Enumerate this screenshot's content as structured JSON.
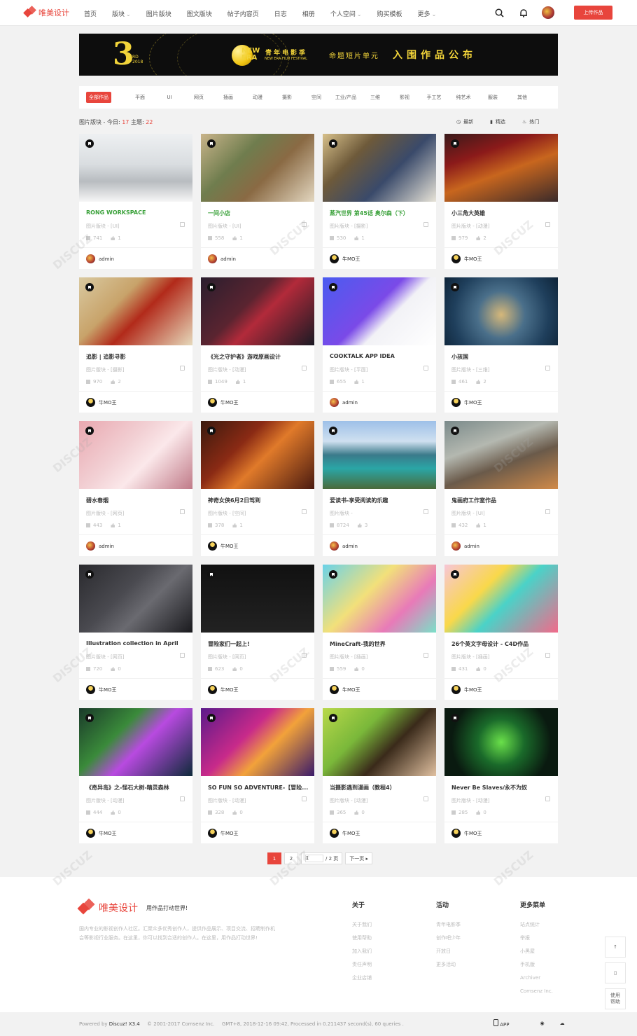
{
  "header": {
    "logo_text": "唯美设计",
    "nav": [
      {
        "label": "首页",
        "sub": false
      },
      {
        "label": "版块",
        "sub": true
      },
      {
        "label": "图片版块",
        "sub": false
      },
      {
        "label": "图文版块",
        "sub": false
      },
      {
        "label": "帖子内容页",
        "sub": false
      },
      {
        "label": "日志",
        "sub": false
      },
      {
        "label": "相册",
        "sub": false
      },
      {
        "label": "个人空间",
        "sub": true
      },
      {
        "label": "购买模板",
        "sub": false
      },
      {
        "label": "更多",
        "sub": true
      }
    ],
    "upload_label": "上传作品",
    "icons": [
      "search-icon",
      "bell-icon",
      "user-avatar"
    ]
  },
  "banner": {
    "num": "3",
    "ordinal": "RD",
    "year": "2018",
    "new_era": "NEW ERA",
    "festival_cn": "青年电影季",
    "festival_en": "NEW ERA FILM FESTIVAL",
    "theme": "命题短片单元",
    "theme2": "入围作品公布"
  },
  "categories": [
    "全部作品",
    "平面",
    "UI",
    "网页",
    "插画",
    "动漫",
    "摄影",
    "空间",
    "工业/产品",
    "三维",
    "影视",
    "手工艺",
    "纯艺术",
    "服装",
    "其他"
  ],
  "stats": {
    "prefix": "图片版块 - 今日: ",
    "today": "17",
    "topics_label": " 主题: ",
    "topics": "22"
  },
  "sort": [
    {
      "label": "最新",
      "icon": "clock-icon"
    },
    {
      "label": "精选",
      "icon": "bookmark-icon"
    },
    {
      "label": "热门",
      "icon": "fire-icon"
    }
  ],
  "cards": [
    {
      "title": "RONG WORKSPACE",
      "green": true,
      "forum": "图片版块 - [UI]",
      "views": "741",
      "likes": "1",
      "user": "admin",
      "avatar": "a",
      "bg": "linear-gradient(180deg,#eef0f2 0%,#d9dde0 45%,#b8bcc0 70%,#f6f6f6 100%)"
    },
    {
      "title": "一间小店",
      "green": true,
      "forum": "图片版块 - [UI]",
      "views": "558",
      "likes": "1",
      "user": "admin",
      "avatar": "a",
      "bg": "linear-gradient(135deg,#c9b48a 0%,#6f7d4e 35%,#8a6a44 60%,#e3d7c0 100%)"
    },
    {
      "title": "蒸汽世界 第45话 奥尔森（下）",
      "green": true,
      "forum": "图片版块 - [摄影]",
      "views": "530",
      "likes": "1",
      "user": "牛MO王",
      "avatar": "n",
      "bg": "linear-gradient(135deg,#d7c08a 0%,#6e5a3a 30%,#3a4a6a 60%,#e8e4d8 100%)"
    },
    {
      "title": "小三角大英雄",
      "green": false,
      "forum": "图片版块 - [动漫]",
      "views": "979",
      "likes": "2",
      "user": "牛MO王",
      "avatar": "n",
      "bg": "linear-gradient(160deg,#3a1a1a 0%,#8b1a1a 30%,#c8661e 55%,#3a2a2a 100%)"
    },
    {
      "title": "追影 | 追影寻影",
      "green": false,
      "forum": "图片版块 - [摄影]",
      "views": "970",
      "likes": "2",
      "user": "牛MO王",
      "avatar": "n",
      "bg": "linear-gradient(135deg,#d9c9a0 0%,#c8a36a 35%,#b22a1a 55%,#e6d9bb 100%)"
    },
    {
      "title": "《光之守护者》游戏原画设计",
      "green": false,
      "forum": "图片版块 - [动漫]",
      "views": "1049",
      "likes": "1",
      "user": "牛MO王",
      "avatar": "n",
      "bg": "linear-gradient(135deg,#2a1e2e 0%,#5a2430 40%,#b22a3a 55%,#1a1a24 100%)"
    },
    {
      "title": "COOKTALK APP IDEA",
      "green": false,
      "forum": "图片版块 - [平面]",
      "views": "655",
      "likes": "1",
      "user": "admin",
      "avatar": "a",
      "bg": "linear-gradient(135deg,#4a5cf0 0%,#7a4ae8 45%,#f2f2f6 60%,#ffffff 100%)"
    },
    {
      "title": "小孩国",
      "green": false,
      "forum": "图片版块 - [三维]",
      "views": "461",
      "likes": "2",
      "user": "牛MO王",
      "avatar": "n",
      "bg": "radial-gradient(circle at 50% 55%,#d6b87a 0%,#4a6f8a 35%,#1f3f5c 70%,#0e2438 100%)"
    },
    {
      "title": "碧水春烟",
      "green": false,
      "forum": "图片版块 - [网页]",
      "views": "443",
      "likes": "1",
      "user": "admin",
      "avatar": "a",
      "bg": "linear-gradient(135deg,#e9a8b0 0%,#f2d0d4 40%,#fbe8ea 60%,#c07a88 100%)"
    },
    {
      "title": "神奇女侠6月2日驾到",
      "green": false,
      "forum": "图片版块 - [空间]",
      "views": "378",
      "likes": "1",
      "user": "牛MO王",
      "avatar": "n",
      "bg": "linear-gradient(135deg,#3a1a0e 0%,#8a2a14 35%,#e07a2a 55%,#4a1a10 100%)"
    },
    {
      "title": "爱读书-享受阅读的乐趣",
      "green": false,
      "forum": "图片版块 -",
      "views": "8724",
      "likes": "3",
      "user": "admin",
      "avatar": "a",
      "bg": "linear-gradient(180deg,#9ec0e8 0%,#cfe0f0 30%,#3a7a8a 50%,#2aa6a6 70%,#4a6a3a 100%)"
    },
    {
      "title": "鬼画府工作室作品",
      "green": false,
      "forum": "图片版块 - [UI]",
      "views": "432",
      "likes": "1",
      "user": "admin",
      "avatar": "a",
      "bg": "linear-gradient(160deg,#7a8a8a 0%,#b4b8b0 35%,#6a5a4a 60%,#d08a4a 100%)"
    },
    {
      "title": "Illustration collection in April",
      "green": false,
      "forum": "图片版块 - [网页]",
      "views": "720",
      "likes": "0",
      "user": "牛MO王",
      "avatar": "n",
      "bg": "linear-gradient(135deg,#2a2a2e 0%,#4a4a50 40%,#6a6a70 60%,#1a1a1e 100%)"
    },
    {
      "title": "冒险家们一起上!",
      "green": false,
      "forum": "图片版块 - [网页]",
      "views": "623",
      "likes": "0",
      "user": "牛MO王",
      "avatar": "n",
      "bg": "linear-gradient(180deg,#111 0%,#222 100%)"
    },
    {
      "title": "MineCraft-我的世界",
      "green": false,
      "forum": "图片版块 - [插画]",
      "views": "559",
      "likes": "0",
      "user": "牛MO王",
      "avatar": "n",
      "bg": "linear-gradient(135deg,#6ad2e8 0%,#f2e07a 40%,#e87ab8 70%,#7ae0c8 100%)"
    },
    {
      "title": "26个英文字母设计 - C4D作品",
      "green": false,
      "forum": "图片版块 - [插画]",
      "views": "431",
      "likes": "0",
      "user": "牛MO王",
      "avatar": "n",
      "bg": "linear-gradient(135deg,#f7c6d6 0%,#f9d84a 35%,#4ad2c8 55%,#f26a8a 100%)"
    },
    {
      "title": "《奇异岛》之-怪石大树-精灵森林",
      "green": false,
      "forum": "图片版块 - [动漫]",
      "views": "444",
      "likes": "0",
      "user": "牛MO王",
      "avatar": "n",
      "bg": "linear-gradient(135deg,#1a3a2a 0%,#3a8a3a 35%,#b84ae0 55%,#0e2a3a 100%)"
    },
    {
      "title": "SO FUN SO ADVENTURE-【冒险...",
      "green": false,
      "forum": "图片版块 - [动漫]",
      "views": "328",
      "likes": "0",
      "user": "牛MO王",
      "avatar": "n",
      "bg": "linear-gradient(135deg,#5a1a8a 0%,#c82a8a 40%,#f2a23a 60%,#3a1a6a 100%)"
    },
    {
      "title": "当摄影遇到漫画（教程4）",
      "green": false,
      "forum": "图片版块 - [动漫]",
      "views": "365",
      "likes": "0",
      "user": "牛MO王",
      "avatar": "n",
      "bg": "linear-gradient(135deg,#b8d84a 0%,#7ab83a 35%,#3a2a1a 60%,#e0c0a0 100%)"
    },
    {
      "title": "Never Be Slaves/永不为奴",
      "green": false,
      "forum": "图片版块 - [动漫]",
      "views": "285",
      "likes": "0",
      "user": "牛MO王",
      "avatar": "n",
      "bg": "radial-gradient(circle at 50% 50%,#6ae04a 0%,#1a6a2a 35%,#0a1a10 75%)"
    }
  ],
  "pager": {
    "current": "1",
    "next_num": "2",
    "total": "/ 2 页",
    "next": "下一页"
  },
  "footer": {
    "name": "唯美设计",
    "slogan": "用作品打动世界!",
    "desc": "国内专业的影视创作人社区。汇聚众多优秀创作人，提供作品展示、项目交流、招聘制作机会等影视行业服务。在这里，你可以找到合适的创作人。在这里，用作品打动世界!",
    "cols": [
      {
        "title": "关于",
        "items": [
          "关于我们",
          "使用帮助",
          "加入我们",
          "责任声明",
          "企业店铺"
        ]
      },
      {
        "title": "活动",
        "items": [
          "青年电影季",
          "创作吧少年",
          "开放日",
          "更多活动"
        ]
      },
      {
        "title": "更多菜单",
        "items": [
          "站点统计",
          "举报",
          "小黑屋",
          "手机版",
          "Archiver",
          "Comsenz Inc."
        ]
      }
    ],
    "tools": [
      "↑",
      "▯",
      "使用\n帮助"
    ],
    "powered_prefix": "Powered by ",
    "powered": "Discuz! X3.4",
    "copyright": "© 2001-2017 Comsenz Inc.",
    "gmt": "GMT+8, 2018-12-16 09:42, Processed in 0.211437 second(s), 60 queries .",
    "app": "APP"
  }
}
